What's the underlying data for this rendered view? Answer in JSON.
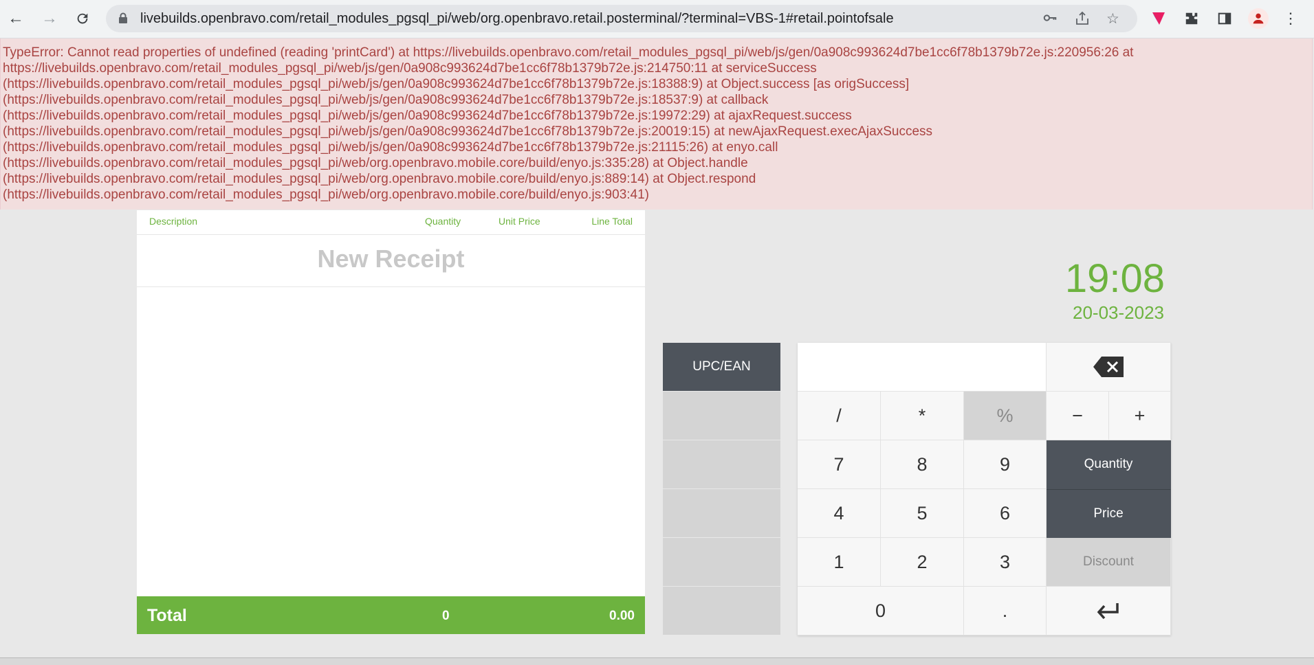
{
  "browser": {
    "url": "livebuilds.openbravo.com/retail_modules_pgsql_pi/web/org.openbravo.retail.posterminal/?terminal=VBS-1#retail.pointofsale",
    "back_icon": "arrow-left",
    "forward_icon": "arrow-right",
    "reload_icon": "reload",
    "lock_icon": "lock"
  },
  "error": {
    "lines": [
      "TypeError: Cannot read properties of undefined (reading 'printCard') at https://livebuilds.openbravo.com/retail_modules_pgsql_pi/web/js/gen/0a908c993624d7be1cc6f78b1379b72e.js:220956:26 at",
      "https://livebuilds.openbravo.com/retail_modules_pgsql_pi/web/js/gen/0a908c993624d7be1cc6f78b1379b72e.js:214750:11 at serviceSuccess",
      "(https://livebuilds.openbravo.com/retail_modules_pgsql_pi/web/js/gen/0a908c993624d7be1cc6f78b1379b72e.js:18388:9) at Object.success [as origSuccess]",
      "(https://livebuilds.openbravo.com/retail_modules_pgsql_pi/web/js/gen/0a908c993624d7be1cc6f78b1379b72e.js:18537:9) at callback",
      "(https://livebuilds.openbravo.com/retail_modules_pgsql_pi/web/js/gen/0a908c993624d7be1cc6f78b1379b72e.js:19972:29) at ajaxRequest.success",
      "(https://livebuilds.openbravo.com/retail_modules_pgsql_pi/web/js/gen/0a908c993624d7be1cc6f78b1379b72e.js:20019:15) at newAjaxRequest.execAjaxSuccess",
      "(https://livebuilds.openbravo.com/retail_modules_pgsql_pi/web/js/gen/0a908c993624d7be1cc6f78b1379b72e.js:21115:26) at enyo.call",
      "(https://livebuilds.openbravo.com/retail_modules_pgsql_pi/web/org.openbravo.mobile.core/build/enyo.js:335:28) at Object.handle",
      "(https://livebuilds.openbravo.com/retail_modules_pgsql_pi/web/org.openbravo.mobile.core/build/enyo.js:889:14) at Object.respond",
      "(https://livebuilds.openbravo.com/retail_modules_pgsql_pi/web/org.openbravo.mobile.core/build/enyo.js:903:41)"
    ]
  },
  "receipt": {
    "headers": {
      "description": "Description",
      "quantity": "Quantity",
      "unit_price": "Unit Price",
      "line_total": "Line Total"
    },
    "title": "New Receipt",
    "total_label": "Total",
    "total_qty": "0",
    "total_amount": "0.00"
  },
  "clock": {
    "time": "19:08",
    "date": "20-03-2023"
  },
  "side": {
    "upc_label": "UPC/EAN"
  },
  "keypad": {
    "slash": "/",
    "star": "*",
    "percent": "%",
    "minus": "−",
    "plus": "+",
    "k7": "7",
    "k8": "8",
    "k9": "9",
    "k4": "4",
    "k5": "5",
    "k6": "6",
    "k1": "1",
    "k2": "2",
    "k3": "3",
    "k0": "0",
    "dot": ".",
    "quantity": "Quantity",
    "price": "Price",
    "discount": "Discount"
  },
  "colors": {
    "accent": "#6db33f",
    "dark_button": "#4e545c",
    "error_text": "#a94442",
    "error_bg": "#f2dede"
  }
}
